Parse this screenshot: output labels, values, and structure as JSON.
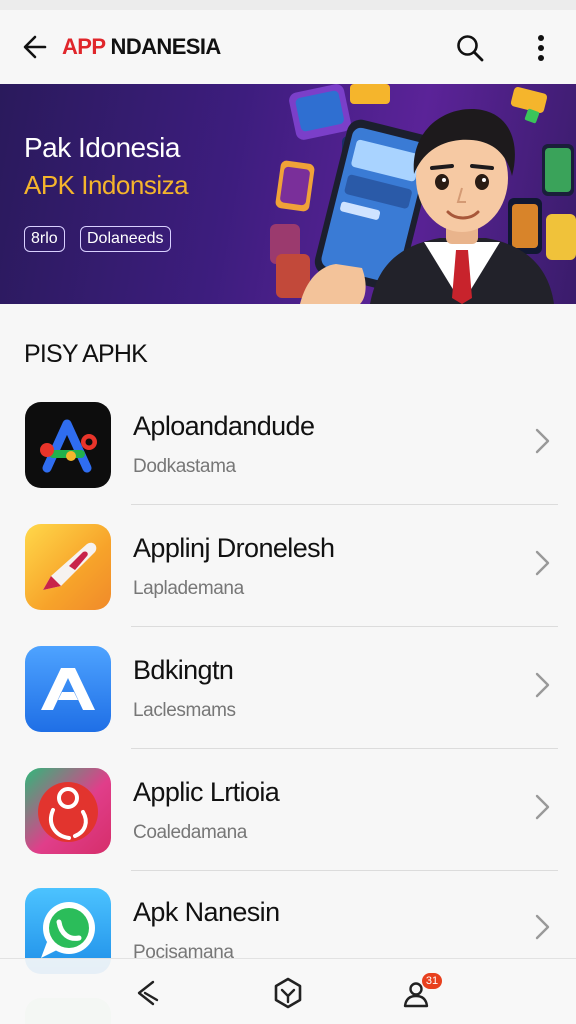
{
  "app_bar": {
    "title_accent": "APP",
    "title_rest": " NDANESIA",
    "back_icon": "arrow-left-icon",
    "search_icon": "search-icon",
    "more_icon": "more-vertical-icon"
  },
  "banner": {
    "title": "Pak Idonesia",
    "subtitle": "APK Indonsiza",
    "chips": [
      "8rlo",
      "Dolaneeds"
    ],
    "accent_color": "#f5b52c",
    "background_color": "#3d1d7e"
  },
  "section": {
    "title": "PISY APHK"
  },
  "apps": [
    {
      "name": "Aploandandude",
      "subtitle": "Dodkastama",
      "icon": "app-a-icon"
    },
    {
      "name": "Applinj Dronelesh",
      "subtitle": "Laplademana",
      "icon": "pen-icon"
    },
    {
      "name": "Bdkingtn",
      "subtitle": "Laclesmams",
      "icon": "letter-a-icon"
    },
    {
      "name": "Applic Lrtioia",
      "subtitle": "Coaledamana",
      "icon": "pin-icon"
    },
    {
      "name": "Apk Nanesin",
      "subtitle": "Pocisamana",
      "icon": "chat-icon"
    }
  ],
  "bottom_nav": {
    "back_icon": "nav-back-icon",
    "home_icon": "nav-home-icon",
    "recent_icon": "nav-profile-icon",
    "badge": "31"
  }
}
